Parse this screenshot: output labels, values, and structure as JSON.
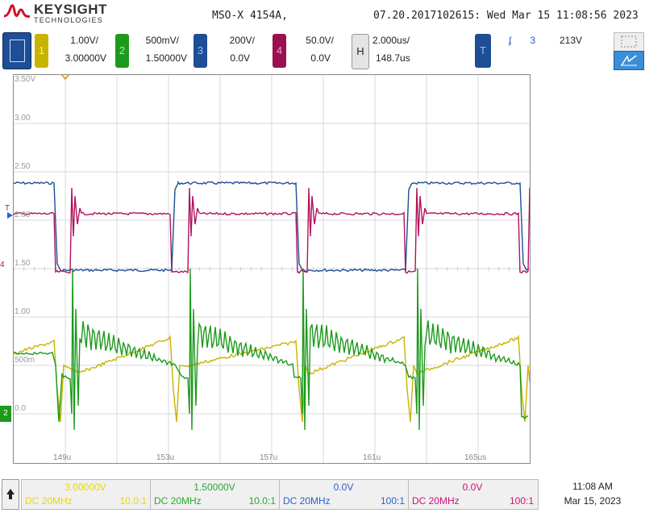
{
  "header": {
    "brand_name": "KEYSIGHT",
    "brand_sub": "TECHNOLOGIES",
    "model": "MSO-X 4154A,",
    "datetime": "07.20.2017102615: Wed Mar 15 11:08:56 2023"
  },
  "channels": [
    {
      "num": "1",
      "scale": "1.00V/",
      "offset": "3.00000V",
      "color": "#c8b400",
      "bg": "#f5ed9c"
    },
    {
      "num": "2",
      "scale": "500mV/",
      "offset": "1.50000V",
      "color": "#1c9a1c",
      "bg": "#b6e6b0"
    },
    {
      "num": "3",
      "scale": "200V/",
      "offset": "0.0V",
      "color": "#1d4e96",
      "bg": "#2a5fb0"
    },
    {
      "num": "4",
      "scale": "50.0V/",
      "offset": "0.0V",
      "color": "#b0125f",
      "bg": "#9a1050"
    }
  ],
  "horizontal": {
    "label": "H",
    "time_div": "2.000us/",
    "delay": "148.7us"
  },
  "trigger": {
    "label": "T",
    "slope": "ʄ",
    "source": "3",
    "level": "213V"
  },
  "y_labels": [
    "3.50V",
    "3.00",
    "2.50",
    "2.00",
    "1.50",
    "1.00",
    "500m",
    "0.0"
  ],
  "x_labels": [
    "149u",
    "153u",
    "157u",
    "161u",
    "165us"
  ],
  "markers": {
    "ch3": "T",
    "ch4": "4",
    "ch2": "2"
  },
  "footer": {
    "cells": [
      {
        "value": "3.00000V",
        "coupling": "DC 20MHz",
        "ratio": "10.0:1",
        "color": "#e8d800"
      },
      {
        "value": "1.50000V",
        "coupling": "DC 20MHz",
        "ratio": "10.0:1",
        "color": "#2aa82a"
      },
      {
        "value": "0.0V",
        "coupling": "DC 20MHz",
        "ratio": "100:1",
        "color": "#2a5fd0"
      },
      {
        "value": "0.0V",
        "coupling": "DC 20MHz",
        "ratio": "100:1",
        "color": "#d0107a"
      }
    ],
    "time": "11:08 AM",
    "date": "Mar 15, 2023"
  }
}
